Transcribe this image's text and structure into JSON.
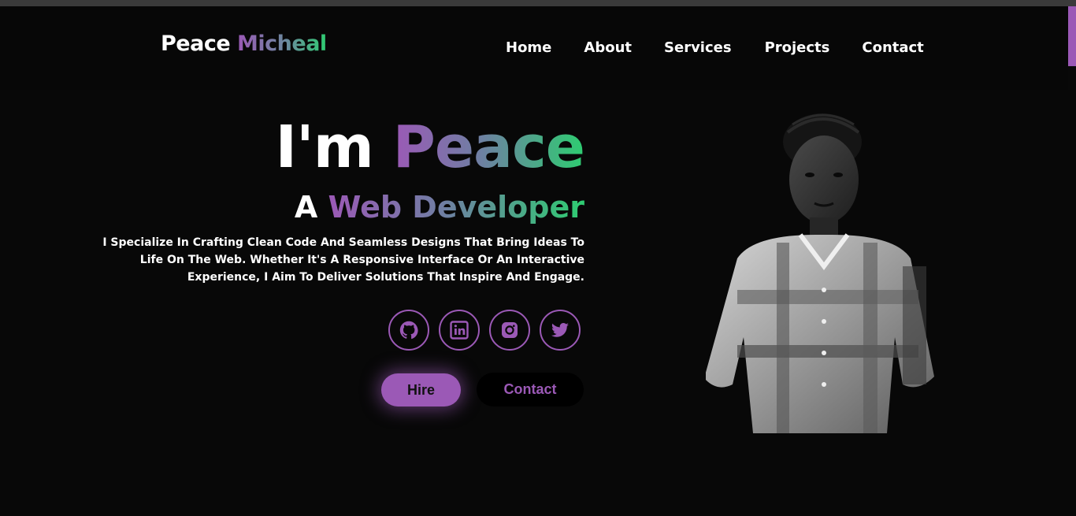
{
  "header": {
    "logo_first": "Peace",
    "logo_last": "Micheal",
    "nav": [
      "Home",
      "About",
      "Services",
      "Projects",
      "Contact"
    ]
  },
  "hero": {
    "title_prefix": "I'm",
    "title_name": "Peace",
    "subtitle_prefix": "A",
    "subtitle_role": "Web Developer",
    "description": "I Specialize In Crafting Clean Code And Seamless Designs That Bring Ideas To Life On The Web. Whether It's A Responsive Interface Or An Interactive Experience, I Aim To Deliver Solutions That Inspire And Engage.",
    "socials": [
      {
        "icon": "github-icon"
      },
      {
        "icon": "linkedin-icon"
      },
      {
        "icon": "instagram-icon"
      },
      {
        "icon": "twitter-icon"
      }
    ],
    "buttons": {
      "hire": "Hire",
      "contact": "Contact"
    },
    "portrait_alt": "portrait-photo"
  },
  "colors": {
    "accent": "#9b59b6",
    "accent_green": "#2ecc71",
    "background": "#080808",
    "text": "#ffffff"
  }
}
